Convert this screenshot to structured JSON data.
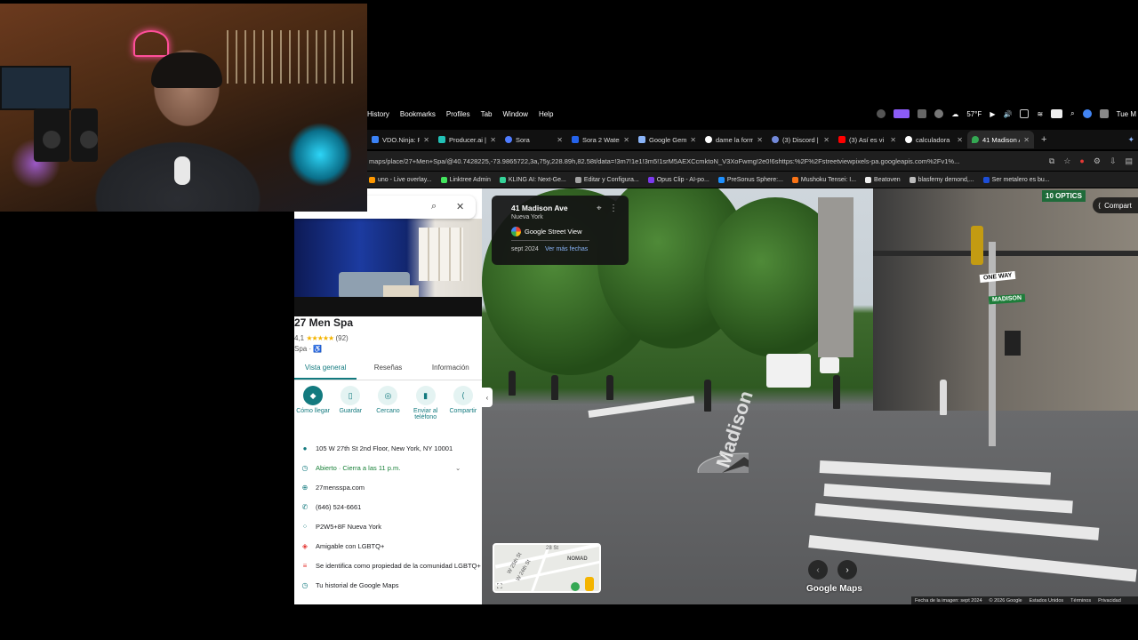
{
  "menubar": {
    "items": [
      "History",
      "Bookmarks",
      "Profiles",
      "Tab",
      "Window",
      "Help"
    ],
    "weather": "57°F",
    "clock": "Tue M"
  },
  "tabs": [
    {
      "label": "VDO.Ninja: R",
      "color": "#3b82f6"
    },
    {
      "label": "Producer.ai |",
      "color": "#22c1b7"
    },
    {
      "label": "Sora",
      "color": "#4f7cff"
    },
    {
      "label": "Sora 2 Water",
      "color": "#2563eb"
    },
    {
      "label": "Google Gem",
      "color": "#8ab4f8"
    },
    {
      "label": "dame la form",
      "color": "#ffffff"
    },
    {
      "label": "(3) Discord |",
      "color": "#7289da"
    },
    {
      "label": "(3) Así es vi",
      "color": "#ff0000"
    },
    {
      "label": "calculadora",
      "color": "#ffffff"
    },
    {
      "label": "41 Madison A",
      "color": "#34a853",
      "active": true
    }
  ],
  "address": {
    "url": "maps/place/27+Men+Spa/@40.7428225,-73.9865722,3a,75y,228.89h,82.58t/data=!3m7!1e1!3m5!1srM5AEXCcmktoN_V3XoFwmg!2e0!6shttps:%2F%2Fstreetviewpixels-pa.googleapis.com%2Fv1%..."
  },
  "bookmarks": [
    {
      "label": "uno - Live overlay...",
      "color": "#ff9800"
    },
    {
      "label": "Linktree Admin",
      "color": "#43e55e"
    },
    {
      "label": "KLING AI: Next-Ge...",
      "color": "#34d399"
    },
    {
      "label": "Editar y Configura...",
      "color": "#a3a3a3"
    },
    {
      "label": "Opus Clip - AI-po...",
      "color": "#7c3aed"
    },
    {
      "label": "PreSonus Sphere:...",
      "color": "#1e90ff"
    },
    {
      "label": "Mushoku Tensei: I...",
      "color": "#f97316"
    },
    {
      "label": "Beatoven",
      "color": "#111111"
    },
    {
      "label": "blasfemy demond,...",
      "color": "#222222"
    },
    {
      "label": "Ser metalero es bu...",
      "color": "#1d4ed8"
    }
  ],
  "place": {
    "title": "27 Men Spa",
    "rating": "4,1",
    "stars": "★★★★★",
    "reviews": "(92)",
    "category": "Spa · ♿",
    "tabs": [
      "Vista general",
      "Reseñas",
      "Información"
    ],
    "actions": [
      {
        "label": "Cómo llegar",
        "icon": "◆"
      },
      {
        "label": "Guardar",
        "icon": "▯"
      },
      {
        "label": "Cercano",
        "icon": "◎"
      },
      {
        "label": "Enviar al teléfono",
        "icon": "▮"
      },
      {
        "label": "Compartir",
        "icon": "⟨"
      }
    ],
    "info": [
      {
        "icon": "●",
        "text": "105 W 27th St 2nd Floor, New York, NY 10001"
      },
      {
        "icon": "◷",
        "text": "Abierto · Cierra a las 11 p.m.",
        "chevron": "⌄"
      },
      {
        "icon": "⊕",
        "text": "27mensspa.com"
      },
      {
        "icon": "✆",
        "text": "(646) 524-6661"
      },
      {
        "icon": "⁘",
        "text": "P2W5+8F Nueva York"
      },
      {
        "icon": "◈",
        "text": "Amigable con LGBTQ+"
      },
      {
        "icon": "≡",
        "text": "Se identifica como propiedad de la comunidad LGBTQ+"
      },
      {
        "icon": "◷",
        "text": "Tu historial de Google Maps"
      }
    ]
  },
  "streetview": {
    "location": "41 Madison Ave",
    "city": "Nueva York",
    "brand": "Google Street View",
    "date": "sept 2024",
    "more_dates": "Ver más fechas",
    "share": "Compart",
    "minimap_labels": [
      "28 St",
      "NOMAD",
      "W 25th St",
      "W 24th St"
    ],
    "logo": "Google Maps",
    "footer": [
      "Fecha de la imagen: sept 2024",
      "© 2026 Google",
      "Estados Unidos",
      "Términos",
      "Privacidad"
    ],
    "signs": [
      "ONE WAY",
      "MADISON"
    ],
    "street_paint": "Madison",
    "banner": "10 OPTICS"
  }
}
